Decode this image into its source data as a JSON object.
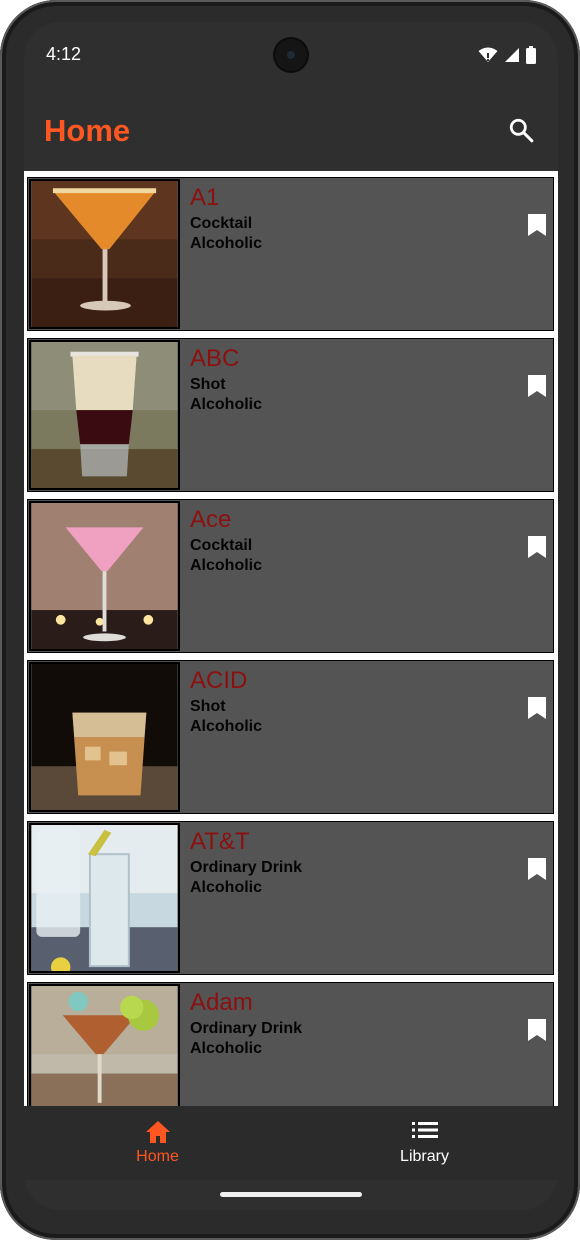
{
  "status": {
    "time": "4:12"
  },
  "appbar": {
    "title": "Home",
    "title_color": "#ff5722",
    "search_icon": "search-icon"
  },
  "drinks": [
    {
      "name": "A1",
      "category": "Cocktail",
      "alcoholic": "Alcoholic",
      "bookmark_icon": "bookmark-icon"
    },
    {
      "name": "ABC",
      "category": "Shot",
      "alcoholic": "Alcoholic",
      "bookmark_icon": "bookmark-icon"
    },
    {
      "name": "Ace",
      "category": "Cocktail",
      "alcoholic": "Alcoholic",
      "bookmark_icon": "bookmark-icon"
    },
    {
      "name": "ACID",
      "category": "Shot",
      "alcoholic": "Alcoholic",
      "bookmark_icon": "bookmark-icon"
    },
    {
      "name": "AT&T",
      "category": "Ordinary Drink",
      "alcoholic": "Alcoholic",
      "bookmark_icon": "bookmark-icon"
    },
    {
      "name": "Adam",
      "category": "Ordinary Drink",
      "alcoholic": "Alcoholic",
      "bookmark_icon": "bookmark-icon"
    }
  ],
  "bottom_nav": {
    "items": [
      {
        "label": "Home",
        "icon": "home-icon",
        "active": true
      },
      {
        "label": "Library",
        "icon": "list-icon",
        "active": false
      }
    ],
    "active_color": "#ff5722"
  },
  "colors": {
    "card_background": "#555455",
    "drink_name": "#8b1010",
    "screen_background": "#2f2f2f"
  }
}
